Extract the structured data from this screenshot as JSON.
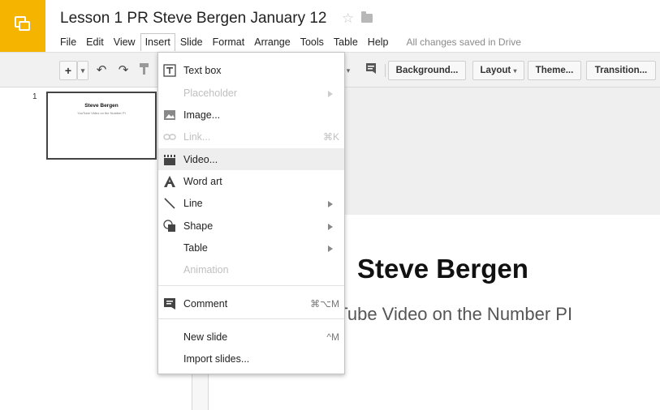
{
  "header": {
    "title": "Lesson 1 PR Steve Bergen January 12",
    "save_status": "All changes saved in Drive",
    "menus": [
      "File",
      "Edit",
      "View",
      "Insert",
      "Slide",
      "Format",
      "Arrange",
      "Tools",
      "Table",
      "Help"
    ],
    "active_menu": "Insert"
  },
  "toolbar": {
    "add": "+",
    "add_arrow": "▾",
    "undo": "↶",
    "redo": "↷",
    "comment_icon": "comment-icon",
    "background": "Background...",
    "layout": "Layout",
    "layout_arrow": "▾",
    "theme": "Theme...",
    "transition": "Transition..."
  },
  "filmstrip": {
    "slide_number": "1",
    "thumb_title": "Steve Bergen",
    "thumb_subtitle": "YouTube Video on the Number PI"
  },
  "slide": {
    "title": "Steve Bergen",
    "subtitle": "uTube Video on the Number PI"
  },
  "insert_menu": {
    "items": [
      {
        "label": "Text box",
        "icon": "text-box-icon"
      },
      {
        "label": "Placeholder",
        "disabled": true,
        "submenu": true
      },
      {
        "label": "Image...",
        "icon": "image-icon"
      },
      {
        "label": "Link...",
        "icon": "link-icon",
        "shortcut": "⌘K",
        "disabled": true
      },
      {
        "label": "Video...",
        "icon": "video-icon",
        "highlighted": true
      },
      {
        "label": "Word art",
        "icon": "word-art-icon"
      },
      {
        "label": "Line",
        "icon": "line-icon",
        "submenu": true
      },
      {
        "label": "Shape",
        "icon": "shape-icon",
        "submenu": true
      },
      {
        "label": "Table",
        "submenu": true
      },
      {
        "label": "Animation",
        "disabled": true
      },
      {
        "label": "Comment",
        "icon": "comment-icon",
        "shortcut": "⌘⌥M"
      },
      {
        "label": "New slide",
        "shortcut": "^M"
      },
      {
        "label": "Import slides..."
      }
    ]
  },
  "colors": {
    "brand": "#f4b400",
    "toolbar_bg": "#f1f1f1",
    "menu_hover": "#eeeeee",
    "disabled_text": "#c0c0c0"
  }
}
